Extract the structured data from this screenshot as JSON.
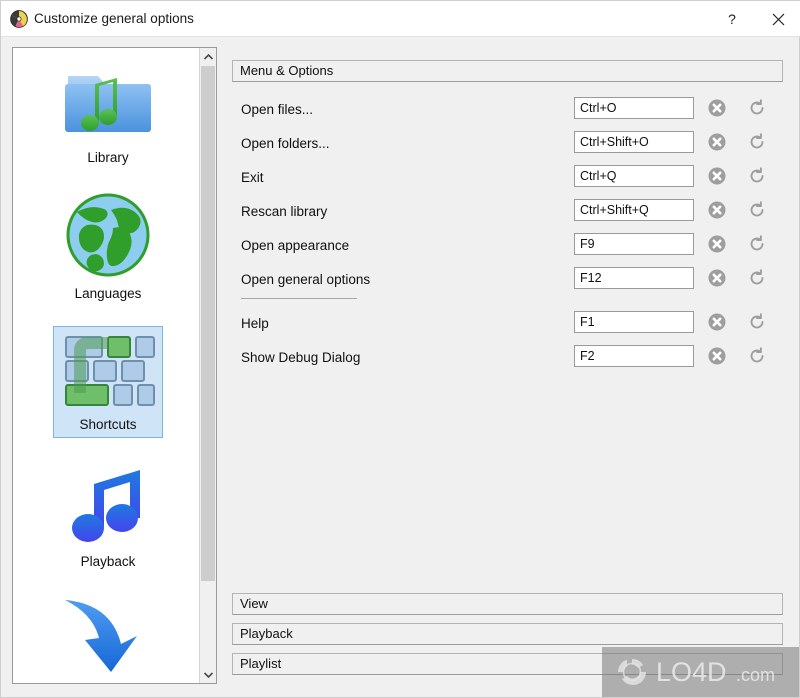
{
  "window": {
    "title": "Customize general options",
    "icon": "app-ball-icon",
    "help_button": "?",
    "close_button": "×"
  },
  "sidebar": {
    "items": [
      {
        "label": "Library",
        "icon": "music-folder-icon",
        "selected": false
      },
      {
        "label": "Languages",
        "icon": "globe-icon",
        "selected": false
      },
      {
        "label": "Shortcuts",
        "icon": "keyboard-keys-icon",
        "selected": true
      },
      {
        "label": "Playback",
        "icon": "music-note-icon",
        "selected": false
      },
      {
        "label": "",
        "icon": "down-arrow-icon",
        "selected": false
      }
    ],
    "scrollbar": {
      "up_arrow": "▲",
      "down_arrow": "▼"
    }
  },
  "main": {
    "groups": {
      "menu_options": "Menu & Options",
      "view": "View",
      "playback": "Playback",
      "playlist": "Playlist"
    },
    "shortcuts": [
      {
        "label": "Open files...",
        "value": "Ctrl+O",
        "separator_after": false,
        "gap_before": false
      },
      {
        "label": "Open folders...",
        "value": "Ctrl+Shift+O",
        "separator_after": false,
        "gap_before": false
      },
      {
        "label": "Exit",
        "value": "Ctrl+Q",
        "separator_after": false,
        "gap_before": false
      },
      {
        "label": "Rescan library",
        "value": "Ctrl+Shift+Q",
        "separator_after": false,
        "gap_before": false
      },
      {
        "label": "Open appearance",
        "value": "F9",
        "separator_after": false,
        "gap_before": false
      },
      {
        "label": "Open general options",
        "value": "F12",
        "separator_after": true,
        "gap_before": false
      },
      {
        "label": "Help",
        "value": "F1",
        "separator_after": false,
        "gap_before": true
      },
      {
        "label": "Show Debug Dialog",
        "value": "F2",
        "separator_after": false,
        "gap_before": false
      }
    ],
    "row_buttons": {
      "clear": "clear-shortcut-icon",
      "reset": "reset-shortcut-icon"
    }
  },
  "watermark": {
    "text": "LO4D.com"
  },
  "colors": {
    "selection": "#cfe5f7",
    "selection_border": "#7eb4e2",
    "window_bg": "#f0f0f0",
    "field_bg": "#ffffff",
    "icon_gray": "#9e9e9e"
  }
}
